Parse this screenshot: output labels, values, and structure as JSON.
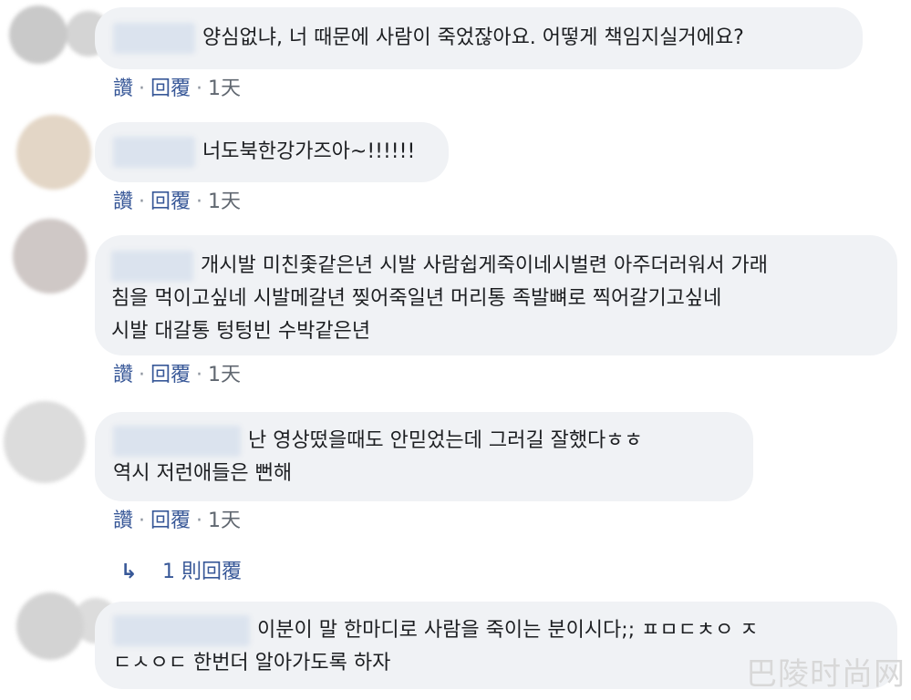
{
  "comments": [
    {
      "lines": [
        "양심없냐, 너 때문에 사람이 죽었잖아요. 어떻게 책임지실거에요?"
      ],
      "like": "讚",
      "reply": "回覆",
      "time": "1天"
    },
    {
      "lines": [
        "너도북한강가즈아~!!!!!!"
      ],
      "like": "讚",
      "reply": "回覆",
      "time": "1天"
    },
    {
      "lines": [
        "개시발 미친좇같은년 시발 사람쉽게죽이네시벌련 아주더러워서 가래",
        "침을 먹이고싶네 시발메갈년 찢어죽일년 머리통 족발뼈로 찍어갈기고싶네",
        "시발 대갈통 텅텅빈 수박같은년"
      ],
      "like": "讚",
      "reply": "回覆",
      "time": "1天"
    },
    {
      "lines": [
        "난 영상떴을때도 안믿었는데 그러길 잘했다ㅎㅎ",
        "역시 저런애들은 뻔해"
      ],
      "like": "讚",
      "reply": "回覆",
      "time": "1天",
      "replies_link": "1 則回覆"
    },
    {
      "lines": [
        "이분이 말 한마디로 사람을 죽이는 분이시다;; ㅍㅁㄷㅊㅇ ㅈ",
        "ㄷㅅㅇㄷ 한번더 알아가도록 하자"
      ]
    }
  ],
  "separator": "·",
  "watermark": "巴陵时尚网",
  "colors": {
    "bubble": "#f0f2f5",
    "link": "#385898"
  }
}
